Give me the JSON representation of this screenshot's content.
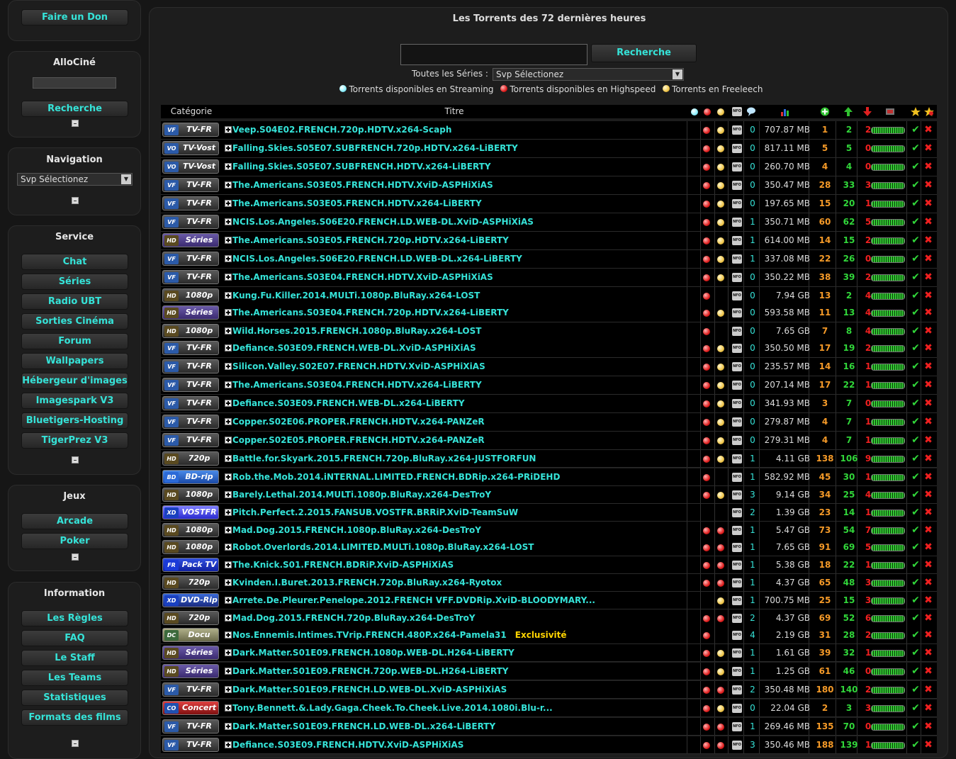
{
  "sidebar": {
    "donate_button": "Faire un Don",
    "allocine": {
      "title": "AlloCiné",
      "search_button": "Recherche"
    },
    "navigation": {
      "title": "Navigation",
      "select_value": "Svp Sélectionez"
    },
    "service": {
      "title": "Service",
      "items": [
        "Chat",
        "Séries",
        "Radio UBT",
        "Sorties Cinéma",
        "Forum",
        "Wallpapers",
        "Hébergeur d'images",
        "Imagespark V3",
        "Bluetigers-Hosting",
        "TigerPrez V3"
      ]
    },
    "jeux": {
      "title": "Jeux",
      "items": [
        "Arcade",
        "Poker"
      ]
    },
    "information": {
      "title": "Information",
      "items": [
        "Les Règles",
        "FAQ",
        "Le Staff",
        "Les Teams",
        "Statistiques",
        "Formats des films"
      ]
    }
  },
  "main": {
    "title": "Les Torrents des 72 dernières heures",
    "search_button": "Recherche",
    "series_label": "Toutes les Séries :",
    "series_select": "Svp Sélectionez",
    "legend": [
      "Torrents disponibles en Streaming",
      "Torrents disponibles en Highspeed",
      "Torrents en Freeleech"
    ],
    "columns": {
      "category": "Catégorie",
      "title": "Titre"
    }
  },
  "colors": {
    "link": "#35e3d8",
    "completed": "#f59a28",
    "seeders": "#31d63a",
    "leechers": "#f02020",
    "exclusive": "#ffd400"
  },
  "torrents": [
    {
      "cat": "TV-FR",
      "logo": "VF",
      "name": "Veep.S04E02.FRENCH.720p.HDTV.x264-Scaph",
      "h": true,
      "f": true,
      "c": "0",
      "size": "707.87 MB",
      "done": "1",
      "seed": "2",
      "leech": "2"
    },
    {
      "cat": "TV-Vost",
      "logo": "VO",
      "name": "Falling.Skies.S05E07.SUBFRENCH.720p.HDTV.x264-LiBERTY",
      "h": true,
      "f": true,
      "c": "0",
      "size": "817.11 MB",
      "done": "5",
      "seed": "5",
      "leech": "0"
    },
    {
      "cat": "TV-Vost",
      "logo": "VO",
      "name": "Falling.Skies.S05E07.SUBFRENCH.HDTV.x264-LiBERTY",
      "h": true,
      "f": true,
      "c": "0",
      "size": "260.70 MB",
      "done": "4",
      "seed": "4",
      "leech": "0"
    },
    {
      "cat": "TV-FR",
      "logo": "VF",
      "name": "The.Americans.S03E05.FRENCH.HDTV.XviD-ASPHiXiAS",
      "h": true,
      "f": true,
      "c": "0",
      "size": "350.47 MB",
      "done": "28",
      "seed": "33",
      "leech": "3"
    },
    {
      "cat": "TV-FR",
      "logo": "VF",
      "name": "The.Americans.S03E05.FRENCH.HDTV.x264-LiBERTY",
      "h": true,
      "f": true,
      "c": "0",
      "size": "197.65 MB",
      "done": "15",
      "seed": "20",
      "leech": "1"
    },
    {
      "cat": "TV-FR",
      "logo": "VF",
      "name": "NCIS.Los.Angeles.S06E20.FRENCH.LD.WEB-DL.XviD-ASPHiXiAS",
      "h": true,
      "f": true,
      "c": "1",
      "size": "350.71 MB",
      "done": "60",
      "seed": "62",
      "leech": "5"
    },
    {
      "cat": "Séries",
      "logo": "HD",
      "name": "The.Americans.S03E05.FRENCH.720p.HDTV.x264-LiBERTY",
      "h": true,
      "f": true,
      "c": "1",
      "size": "614.00 MB",
      "done": "14",
      "seed": "15",
      "leech": "2"
    },
    {
      "cat": "TV-FR",
      "logo": "VF",
      "name": "NCIS.Los.Angeles.S06E20.FRENCH.LD.WEB-DL.x264-LiBERTY",
      "h": true,
      "f": true,
      "c": "1",
      "size": "337.08 MB",
      "done": "22",
      "seed": "26",
      "leech": "0"
    },
    {
      "cat": "TV-FR",
      "logo": "VF",
      "name": "The.Americans.S03E04.FRENCH.HDTV.XviD-ASPHiXiAS",
      "h": true,
      "f": true,
      "c": "0",
      "size": "350.22 MB",
      "done": "38",
      "seed": "39",
      "leech": "2"
    },
    {
      "cat": "1080p",
      "logo": "HD",
      "name": "Kung.Fu.Killer.2014.MULTi.1080p.BluRay.x264-LOST",
      "h": true,
      "f": false,
      "c": "0",
      "size": "7.94 GB",
      "done": "13",
      "seed": "2",
      "leech": "4"
    },
    {
      "cat": "Séries",
      "logo": "HD",
      "name": "The.Americans.S03E04.FRENCH.720p.HDTV.x264-LiBERTY",
      "h": true,
      "f": true,
      "c": "0",
      "size": "593.58 MB",
      "done": "11",
      "seed": "13",
      "leech": "4"
    },
    {
      "cat": "1080p",
      "logo": "HD",
      "name": "Wild.Horses.2015.FRENCH.1080p.BluRay.x264-LOST",
      "h": true,
      "f": false,
      "c": "0",
      "size": "7.65 GB",
      "done": "7",
      "seed": "8",
      "leech": "4"
    },
    {
      "cat": "TV-FR",
      "logo": "VF",
      "name": "Defiance.S03E09.FRENCH.WEB-DL.XviD-ASPHiXiAS",
      "h": true,
      "f": true,
      "c": "0",
      "size": "350.50 MB",
      "done": "17",
      "seed": "19",
      "leech": "2"
    },
    {
      "cat": "TV-FR",
      "logo": "VF",
      "name": "Silicon.Valley.S02E07.FRENCH.HDTV.XviD-ASPHiXiAS",
      "h": true,
      "f": true,
      "c": "0",
      "size": "235.57 MB",
      "done": "14",
      "seed": "16",
      "leech": "1"
    },
    {
      "cat": "TV-FR",
      "logo": "VF",
      "name": "The.Americans.S03E04.FRENCH.HDTV.x264-LiBERTY",
      "h": true,
      "f": true,
      "c": "0",
      "size": "207.14 MB",
      "done": "17",
      "seed": "22",
      "leech": "1"
    },
    {
      "cat": "TV-FR",
      "logo": "VF",
      "name": "Defiance.S03E09.FRENCH.WEB-DL.x264-LiBERTY",
      "h": true,
      "f": true,
      "c": "0",
      "size": "341.93 MB",
      "done": "3",
      "seed": "7",
      "leech": "0"
    },
    {
      "cat": "TV-FR",
      "logo": "VF",
      "name": "Copper.S02E06.PROPER.FRENCH.HDTV.x264-PANZeR",
      "h": true,
      "f": true,
      "c": "0",
      "size": "279.87 MB",
      "done": "4",
      "seed": "7",
      "leech": "1"
    },
    {
      "cat": "TV-FR",
      "logo": "VF",
      "name": "Copper.S02E05.PROPER.FRENCH.HDTV.x264-PANZeR",
      "h": true,
      "f": true,
      "c": "0",
      "size": "279.31 MB",
      "done": "4",
      "seed": "7",
      "leech": "1"
    },
    {
      "cat": "720p",
      "logo": "HD",
      "name": "Battle.for.Skyark.2015.FRENCH.720p.BluRay.x264-JUSTFORFUN",
      "h": true,
      "f": true,
      "c": "1",
      "size": "4.11 GB",
      "done": "138",
      "seed": "106",
      "leech": "9"
    },
    {
      "cat": "BD-rip",
      "logo": "BD",
      "name": "Rob.the.Mob.2014.iNTERNAL.LIMITED.FRENCH.BDRip.x264-PRiDEHD",
      "h": true,
      "f": false,
      "c": "1",
      "size": "582.92 MB",
      "done": "45",
      "seed": "30",
      "leech": "1"
    },
    {
      "cat": "1080p",
      "logo": "HD",
      "name": "Barely.Lethal.2014.MULTi.1080p.BluRay.x264-DesTroY",
      "h": true,
      "f": true,
      "c": "3",
      "size": "9.14 GB",
      "done": "34",
      "seed": "25",
      "leech": "4"
    },
    {
      "cat": "VOSTFR",
      "logo": "XD",
      "name": "Pitch.Perfect.2.2015.FANSUB.VOSTFR.BRRiP.XviD-TeamSuW",
      "h": false,
      "f": false,
      "c": "2",
      "size": "1.39 GB",
      "done": "23",
      "seed": "14",
      "leech": "1"
    },
    {
      "cat": "1080p",
      "logo": "HD",
      "name": "Mad.Dog.2015.FRENCH.1080p.BluRay.x264-DesTroY",
      "s": true,
      "h": true,
      "f": true,
      "c": "1",
      "size": "5.47 GB",
      "done": "73",
      "seed": "54",
      "leech": "7"
    },
    {
      "cat": "1080p",
      "logo": "HD",
      "name": "Robot.Overlords.2014.LIMITED.MULTi.1080p.BluRay.x264-LOST",
      "s": true,
      "h": true,
      "f": true,
      "c": "1",
      "size": "7.65 GB",
      "done": "91",
      "seed": "69",
      "leech": "5"
    },
    {
      "cat": "Pack TV",
      "logo": "FR",
      "name": "The.Knick.S01.FRENCH.BDRiP.XviD-ASPHiXiAS",
      "s": true,
      "h": true,
      "f": true,
      "c": "1",
      "size": "5.38 GB",
      "done": "18",
      "seed": "22",
      "leech": "1"
    },
    {
      "cat": "720p",
      "logo": "HD",
      "name": "Kvinden.I.Buret.2013.FRENCH.720p.BluRay.x264-Ryotox",
      "s": true,
      "h": true,
      "f": true,
      "c": "1",
      "size": "4.37 GB",
      "done": "65",
      "seed": "48",
      "leech": "3"
    },
    {
      "cat": "DVD-Rip",
      "logo": "XD",
      "name": "Arrete.De.Pleurer.Penelope.2012.FRENCH VFF.DVDRip.XviD-BLOODYMARY...",
      "s": false,
      "h": false,
      "f": true,
      "c": "1",
      "size": "700.75 MB",
      "done": "25",
      "seed": "15",
      "leech": "3"
    },
    {
      "cat": "720p",
      "logo": "HD",
      "name": "Mad.Dog.2015.FRENCH.720p.BluRay.x264-DesTroY",
      "s": true,
      "h": true,
      "f": true,
      "c": "2",
      "size": "4.37 GB",
      "done": "69",
      "seed": "52",
      "leech": "6"
    },
    {
      "cat": "Docu",
      "logo": "DC",
      "name": "Nos.Ennemis.Intimes.TVrip.FRENCH.480P.x264-Pamela31",
      "exclusive": "Exclusivité",
      "h": true,
      "f": false,
      "c": "4",
      "size": "2.19 GB",
      "done": "31",
      "seed": "28",
      "leech": "2"
    },
    {
      "cat": "Séries",
      "logo": "HD",
      "name": "Dark.Matter.S01E09.FRENCH.1080p.WEB-DL.H264-LiBERTY",
      "h": true,
      "f": true,
      "c": "1",
      "size": "1.61 GB",
      "done": "39",
      "seed": "32",
      "leech": "1"
    },
    {
      "cat": "Séries",
      "logo": "HD",
      "name": "Dark.Matter.S01E09.FRENCH.720p.WEB-DL.H264-LiBERTY",
      "h": true,
      "f": true,
      "c": "1",
      "size": "1.25 GB",
      "done": "61",
      "seed": "46",
      "leech": "0"
    },
    {
      "cat": "TV-FR",
      "logo": "VF",
      "name": "Dark.Matter.S01E09.FRENCH.LD.WEB-DL.XviD-ASPHiXiAS",
      "s": true,
      "h": true,
      "f": true,
      "c": "2",
      "size": "350.48 MB",
      "done": "180",
      "seed": "140",
      "leech": "2"
    },
    {
      "cat": "Concert",
      "logo": "CO",
      "name": "Tony.Bennett.&.Lady.Gaga.Cheek.To.Cheek.Live.2014.1080i.Blu-r...",
      "h": true,
      "f": true,
      "c": "0",
      "size": "22.04 GB",
      "done": "2",
      "seed": "3",
      "leech": "3"
    },
    {
      "cat": "TV-FR",
      "logo": "VF",
      "name": "Dark.Matter.S01E09.FRENCH.LD.WEB-DL.x264-LiBERTY",
      "s": true,
      "h": true,
      "f": true,
      "c": "1",
      "size": "269.46 MB",
      "done": "135",
      "seed": "70",
      "leech": "0"
    },
    {
      "cat": "TV-FR",
      "logo": "VF",
      "name": "Defiance.S03E09.FRENCH.HDTV.XviD-ASPHiXiAS",
      "s": true,
      "h": true,
      "f": true,
      "c": "3",
      "size": "350.46 MB",
      "done": "188",
      "seed": "139",
      "leech": "1"
    }
  ]
}
